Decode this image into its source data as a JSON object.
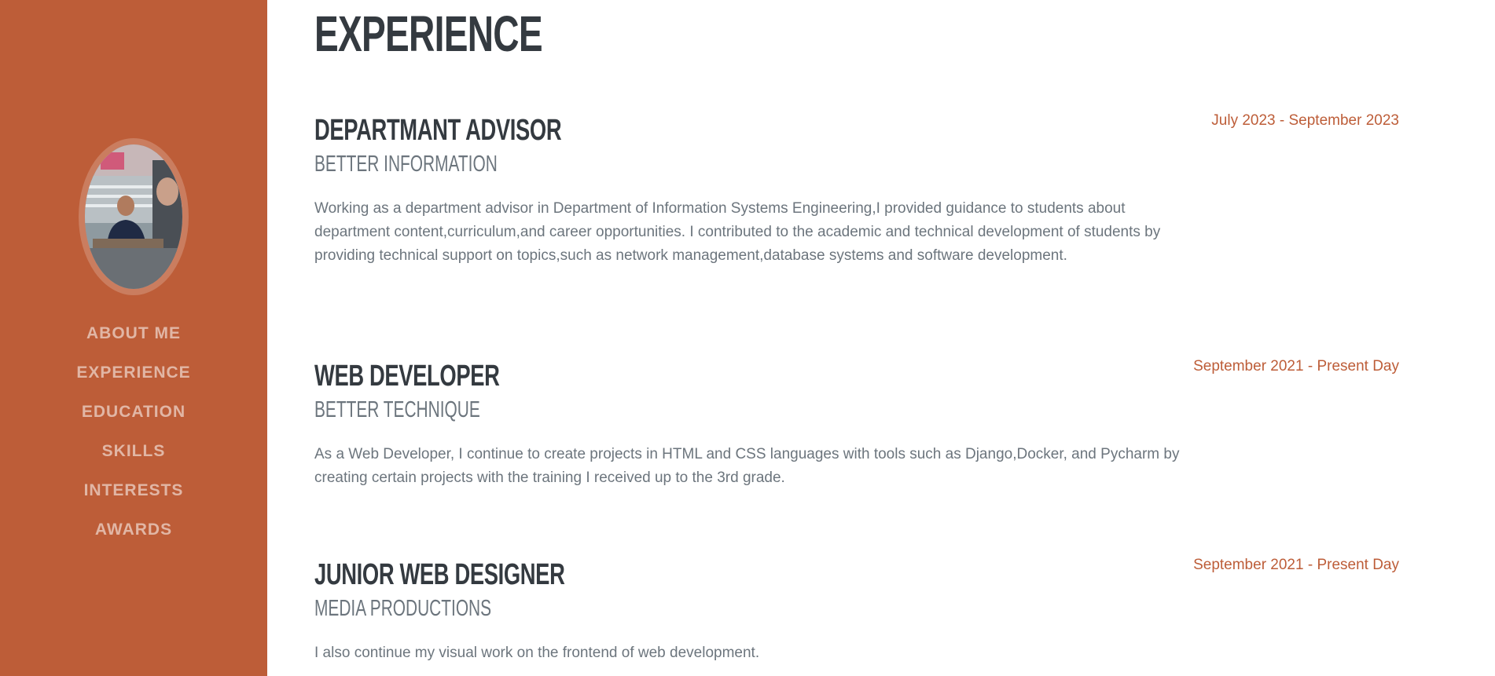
{
  "sidebar": {
    "nav_items": [
      {
        "label": "ABOUT ME"
      },
      {
        "label": "EXPERIENCE"
      },
      {
        "label": "EDUCATION"
      },
      {
        "label": "SKILLS"
      },
      {
        "label": "INTERESTS"
      },
      {
        "label": "AWARDS"
      }
    ]
  },
  "main": {
    "section_title": "EXPERIENCE",
    "entries": [
      {
        "title": "DEPARTMANT ADVISOR",
        "company": "BETTER INFORMATION",
        "description": "Working as a department advisor in Department of Information Systems Engineering,I provided guidance to students about department content,curriculum,and career opportunities. I contributed to the academic and technical development of students by providing technical support on topics,such as network management,database systems and software development.",
        "date": "July 2023 - September 2023"
      },
      {
        "title": "WEB DEVELOPER",
        "company": "BETTER TECHNIQUE",
        "description": "As a Web Developer, I continue to create projects in HTML and CSS languages with tools such as Django,Docker, and Pycharm by creating certain projects with the training I received up to the 3rd grade.",
        "date": "September 2021 - Present Day"
      },
      {
        "title": "JUNIOR WEB DESIGNER",
        "company": "MEDIA PRODUCTIONS",
        "description": "I also continue my visual work on the frontend of web development.",
        "date": "September 2021 - Present Day"
      }
    ]
  },
  "colors": {
    "sidebar_bg": "#bd5d38",
    "accent": "#bd5d38",
    "heading": "#343a40",
    "muted": "#6c757d"
  }
}
